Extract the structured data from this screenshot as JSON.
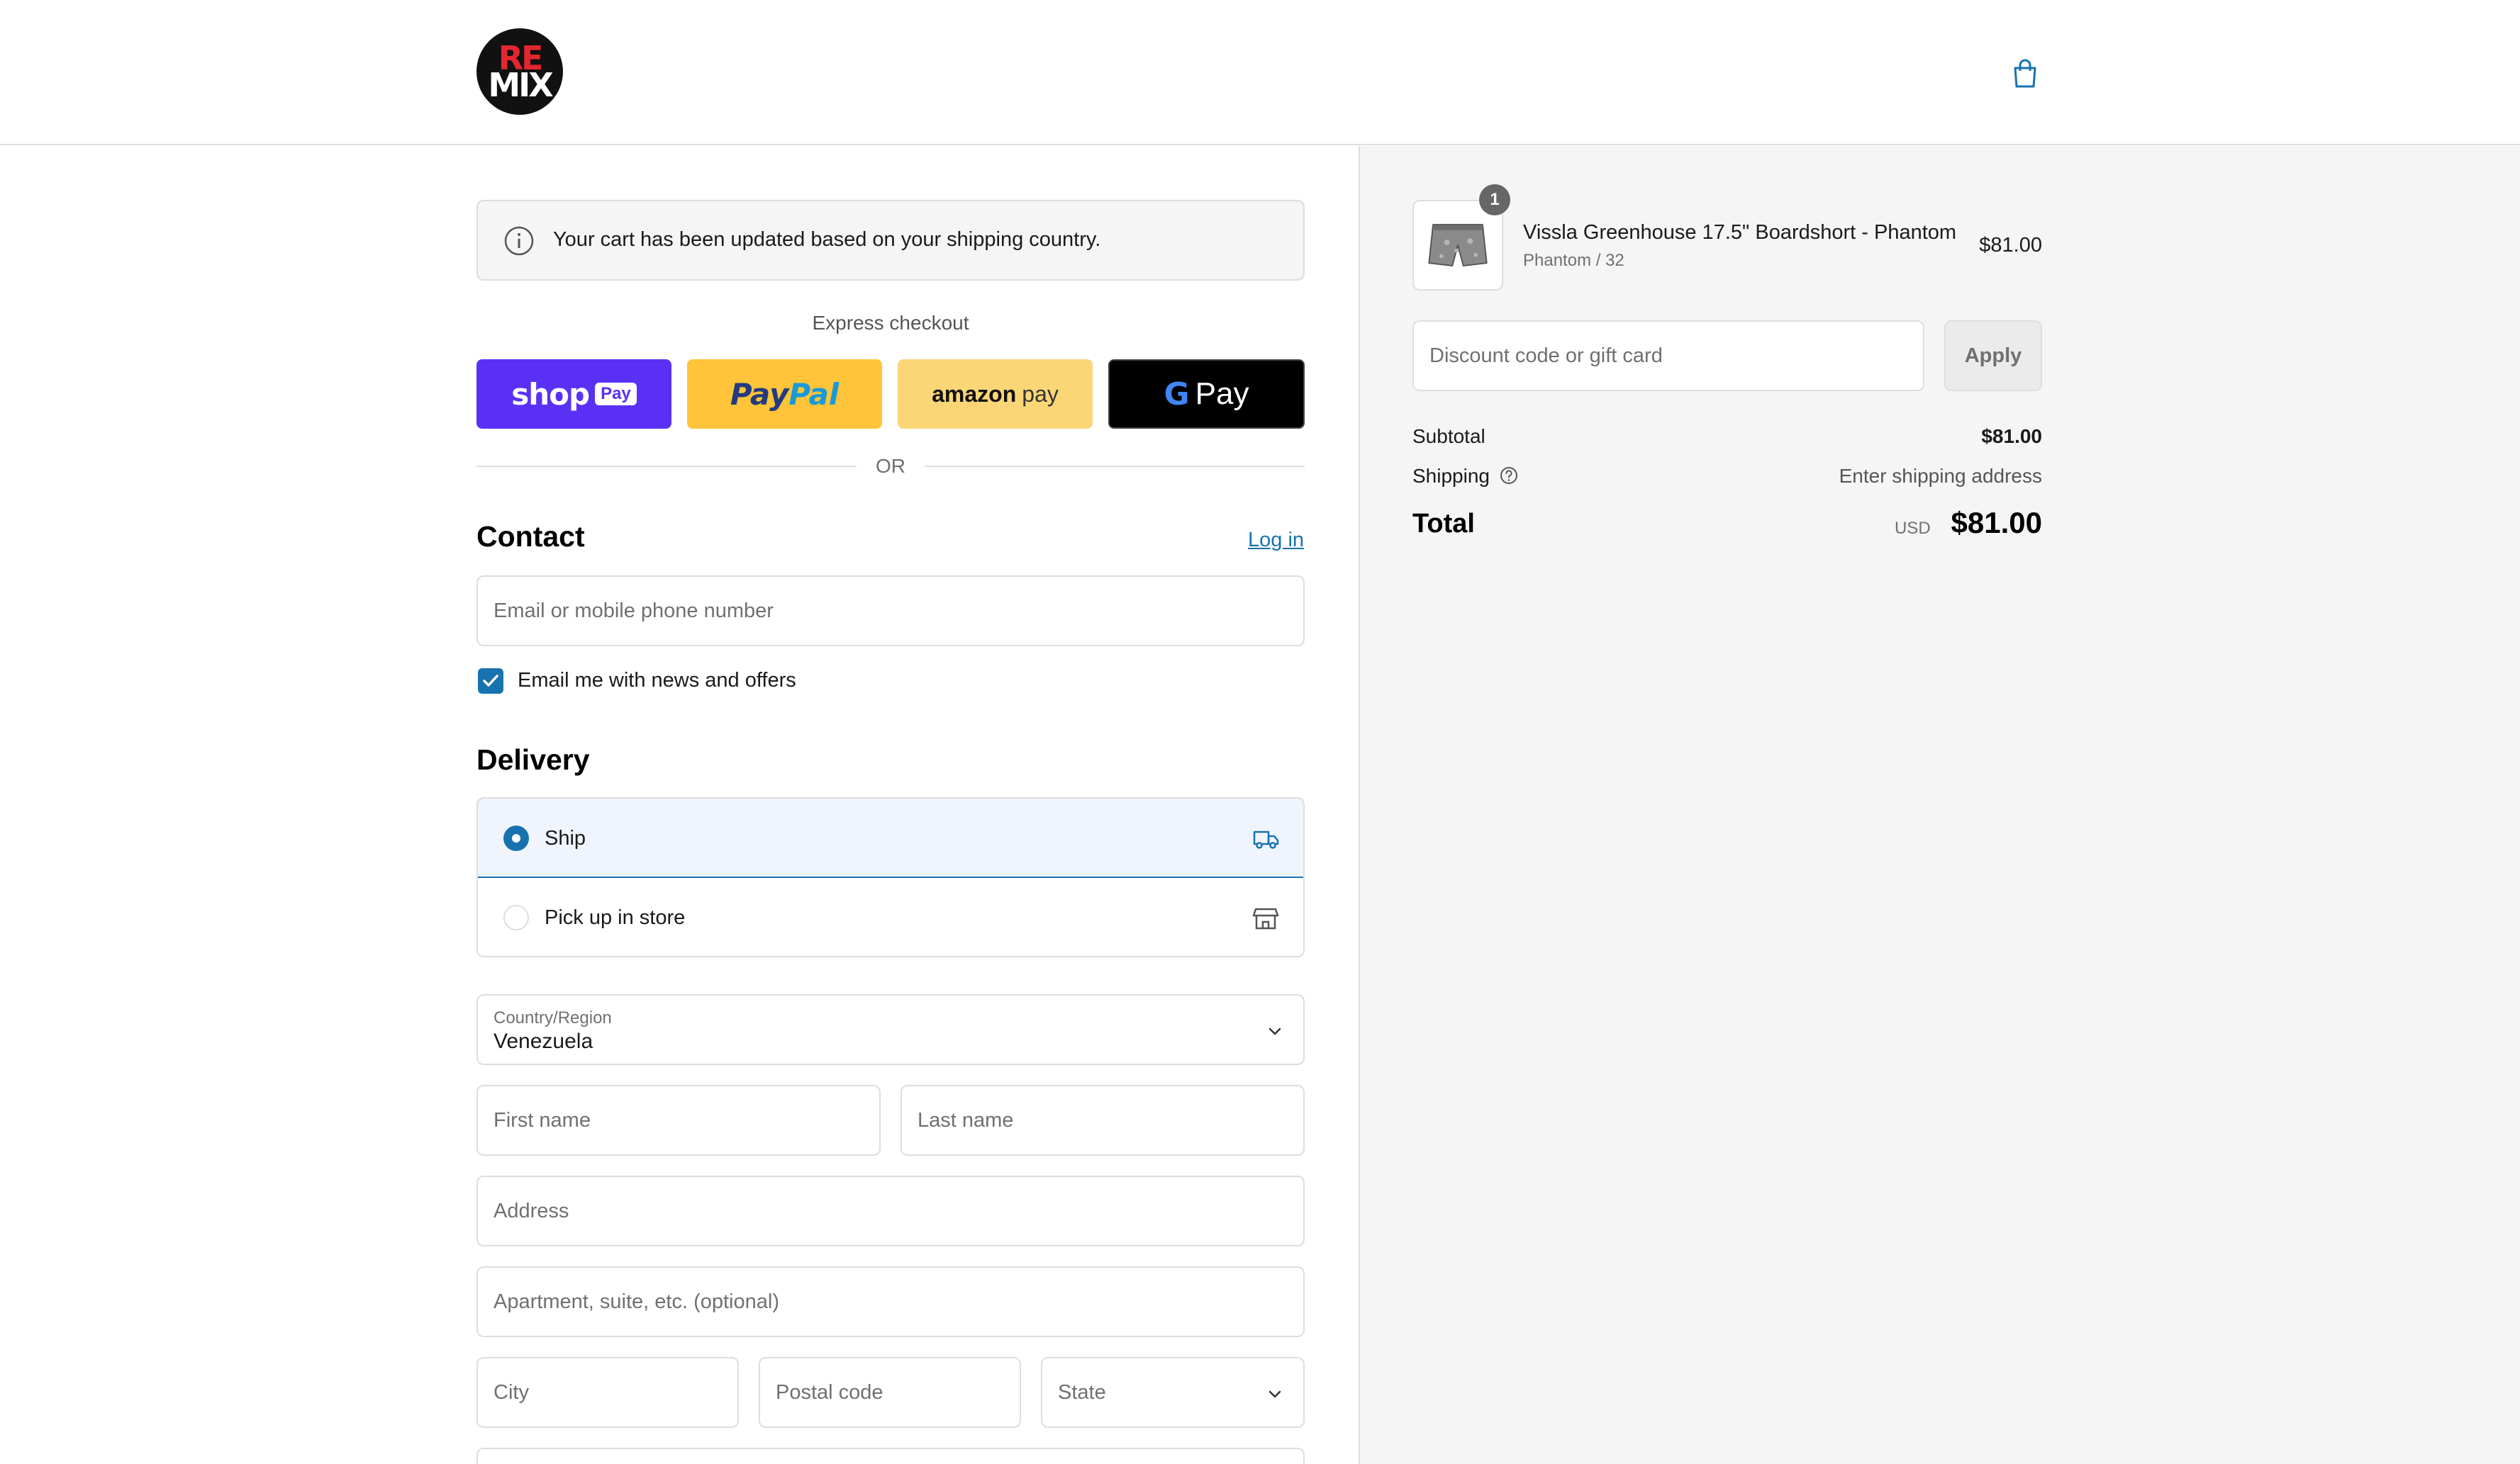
{
  "brand": {
    "logo_top": "RE",
    "logo_bottom": "MIX"
  },
  "notice": {
    "text": "Your cart has been updated based on your shipping country."
  },
  "express": {
    "label": "Express checkout",
    "shop_pay": {
      "word": "shop",
      "chip": "Pay"
    },
    "paypal": {
      "part1": "Pay",
      "part2": "Pal"
    },
    "amazon_pay": {
      "word": "amazon",
      "suffix": "pay"
    },
    "google_pay": {
      "g": "G",
      "word": "Pay"
    },
    "or_label": "OR"
  },
  "contact": {
    "title": "Contact",
    "login_link": "Log in",
    "email_placeholder": "Email or mobile phone number",
    "newsletter_label": "Email me with news and offers",
    "newsletter_checked": true
  },
  "delivery": {
    "title": "Delivery",
    "options": [
      {
        "label": "Ship",
        "selected": true,
        "icon": "truck-icon"
      },
      {
        "label": "Pick up in store",
        "selected": false,
        "icon": "store-icon"
      }
    ],
    "country_label": "Country/Region",
    "country_value": "Venezuela",
    "first_name_placeholder": "First name",
    "last_name_placeholder": "Last name",
    "address_placeholder": "Address",
    "apartment_placeholder": "Apartment, suite, etc. (optional)",
    "city_placeholder": "City",
    "postal_placeholder": "Postal code",
    "state_placeholder": "State"
  },
  "order": {
    "item": {
      "quantity": "1",
      "name": "Vissla Greenhouse 17.5\" Boardshort - Phantom",
      "variant": "Phantom / 32",
      "price": "$81.00"
    },
    "discount_placeholder": "Discount code or gift card",
    "apply_label": "Apply",
    "subtotal_label": "Subtotal",
    "subtotal_value": "$81.00",
    "shipping_label": "Shipping",
    "shipping_value": "Enter shipping address",
    "total_label": "Total",
    "currency": "USD",
    "total_value": "$81.00"
  },
  "colors": {
    "accent": "#1773b0",
    "shop_pay": "#5a31f4",
    "paypal": "#ffc439",
    "amazon_pay": "#fad676",
    "google_pay": "#000000"
  }
}
